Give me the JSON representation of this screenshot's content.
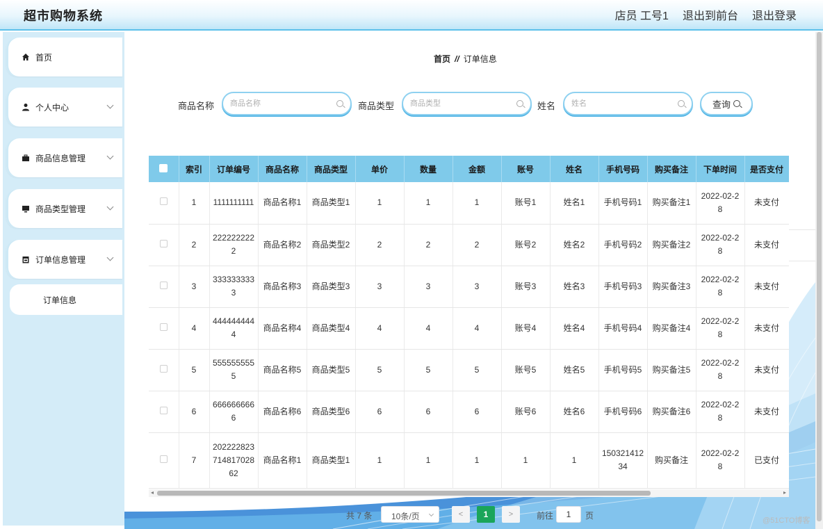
{
  "app": {
    "title": "超市购物系统",
    "user_label": "店员 工号1",
    "back_to_front": "退出到前台",
    "logout": "退出登录"
  },
  "sidebar": {
    "items": [
      {
        "label": "首页",
        "icon": "home-icon"
      },
      {
        "label": "个人中心",
        "icon": "user-icon"
      },
      {
        "label": "商品信息管理",
        "icon": "briefcase-icon"
      },
      {
        "label": "商品类型管理",
        "icon": "monitor-icon"
      },
      {
        "label": "订单信息管理",
        "icon": "calendar-icon"
      }
    ],
    "sub_item": "订单信息"
  },
  "breadcrumb": {
    "home": "首页",
    "separator": "//",
    "current": "订单信息"
  },
  "search": {
    "product_name_label": "商品名称",
    "product_name_placeholder": "商品名称",
    "product_type_label": "商品类型",
    "product_type_placeholder": "商品类型",
    "name_label": "姓名",
    "name_placeholder": "姓名",
    "query_button": "查询"
  },
  "table": {
    "headers": [
      "索引",
      "订单编号",
      "商品名称",
      "商品类型",
      "单价",
      "数量",
      "金额",
      "账号",
      "姓名",
      "手机号码",
      "购买备注",
      "下单时间",
      "是否支付"
    ],
    "rows": [
      [
        "1",
        "1111111111",
        "商品名称1",
        "商品类型1",
        "1",
        "1",
        "1",
        "账号1",
        "姓名1",
        "手机号码1",
        "购买备注1",
        "2022-02-28",
        "未支付"
      ],
      [
        "2",
        "2222222222",
        "商品名称2",
        "商品类型2",
        "2",
        "2",
        "2",
        "账号2",
        "姓名2",
        "手机号码2",
        "购买备注2",
        "2022-02-28",
        "未支付"
      ],
      [
        "3",
        "3333333333",
        "商品名称3",
        "商品类型3",
        "3",
        "3",
        "3",
        "账号3",
        "姓名3",
        "手机号码3",
        "购买备注3",
        "2022-02-28",
        "未支付"
      ],
      [
        "4",
        "4444444444",
        "商品名称4",
        "商品类型4",
        "4",
        "4",
        "4",
        "账号4",
        "姓名4",
        "手机号码4",
        "购买备注4",
        "2022-02-28",
        "未支付"
      ],
      [
        "5",
        "5555555555",
        "商品名称5",
        "商品类型5",
        "5",
        "5",
        "5",
        "账号5",
        "姓名5",
        "手机号码5",
        "购买备注5",
        "2022-02-28",
        "未支付"
      ],
      [
        "6",
        "6666666666",
        "商品名称6",
        "商品类型6",
        "6",
        "6",
        "6",
        "账号6",
        "姓名6",
        "手机号码6",
        "购买备注6",
        "2022-02-28",
        "未支付"
      ],
      [
        "7",
        "20222282371481702862",
        "商品名称1",
        "商品类型1",
        "1",
        "1",
        "1",
        "1",
        "1",
        "15032141234",
        "购买备注",
        "2022-02-28",
        "已支付"
      ]
    ]
  },
  "pagination": {
    "total": "共 7 条",
    "page_size": "10条/页",
    "prev": "<",
    "current_page": "1",
    "next": ">",
    "goto_label": "前往",
    "goto_value": "1",
    "page_unit": "页"
  },
  "watermark": "@51CTO博客",
  "colors": {
    "header_gradient_end": "#bfe6f8",
    "sidebar_bg": "#d4ecf8",
    "table_header": "#7fcaea",
    "active_page": "#1aa55a"
  }
}
